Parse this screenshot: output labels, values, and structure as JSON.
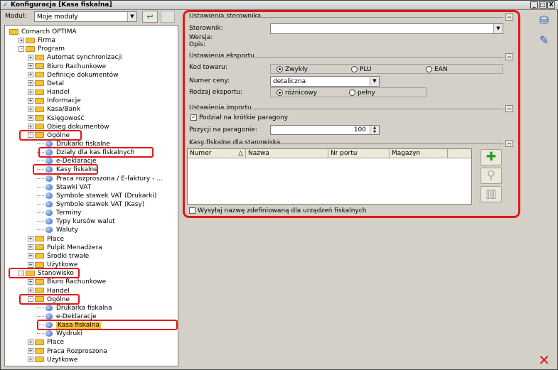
{
  "window": {
    "title": "Konfiguracja [Kasa fiskalna]"
  },
  "module": {
    "label": "Moduł:",
    "value": "Moje moduły"
  },
  "tree": [
    {
      "label": "Comarch OPTIMA",
      "kind": "folder",
      "expander": ""
    },
    {
      "label": "Firma",
      "kind": "folder",
      "expander": "+"
    },
    {
      "label": "Program",
      "kind": "folder",
      "expander": "-"
    },
    {
      "label": "Automat synchronizacji",
      "kind": "folder",
      "expander": "+"
    },
    {
      "label": "Biuro Rachunkowe",
      "kind": "folder",
      "expander": "+"
    },
    {
      "label": "Definicje dokumentów",
      "kind": "folder",
      "expander": "+"
    },
    {
      "label": "Detal",
      "kind": "folder",
      "expander": "+"
    },
    {
      "label": "Handel",
      "kind": "folder",
      "expander": "+"
    },
    {
      "label": "Informacje",
      "kind": "folder",
      "expander": "+"
    },
    {
      "label": "Kasa/Bank",
      "kind": "folder",
      "expander": "+"
    },
    {
      "label": "Księgowość",
      "kind": "folder",
      "expander": "+"
    },
    {
      "label": "Obieg dokumentów",
      "kind": "folder",
      "expander": "+"
    },
    {
      "label": "Ogólne",
      "kind": "folder",
      "expander": "-"
    },
    {
      "label": "Drukarki fiskalne",
      "kind": "leaf",
      "expander": ""
    },
    {
      "label": "Działy dla kas fiskalnych",
      "kind": "leaf",
      "expander": ""
    },
    {
      "label": "e-Deklaracje",
      "kind": "leaf",
      "expander": ""
    },
    {
      "label": "Kasy fiskalne",
      "kind": "leaf",
      "expander": ""
    },
    {
      "label": "Praca rozproszona / E-faktury - ...",
      "kind": "leaf",
      "expander": ""
    },
    {
      "label": "Stawki VAT",
      "kind": "leaf",
      "expander": ""
    },
    {
      "label": "Symbole stawek VAT (Drukarki)",
      "kind": "leaf",
      "expander": ""
    },
    {
      "label": "Symbole stawek VAT (Kasy)",
      "kind": "leaf",
      "expander": ""
    },
    {
      "label": "Terminy",
      "kind": "leaf",
      "expander": ""
    },
    {
      "label": "Typy kursów walut",
      "kind": "leaf",
      "expander": ""
    },
    {
      "label": "Waluty",
      "kind": "leaf",
      "expander": ""
    },
    {
      "label": "Płace",
      "kind": "folder",
      "expander": "+"
    },
    {
      "label": "Pulpit Menadżera",
      "kind": "folder",
      "expander": "+"
    },
    {
      "label": "Środki trwałe",
      "kind": "folder",
      "expander": "+"
    },
    {
      "label": "Użytkowe",
      "kind": "folder",
      "expander": "+"
    },
    {
      "label": "Stanowisko",
      "kind": "folder",
      "expander": "-"
    },
    {
      "label": "Biuro Rachunkowe",
      "kind": "folder",
      "expander": "+"
    },
    {
      "label": "Handel",
      "kind": "folder",
      "expander": "+"
    },
    {
      "label": "Ogólne",
      "kind": "folder",
      "expander": "-"
    },
    {
      "label": "Drukarka fiskalna",
      "kind": "leaf",
      "expander": ""
    },
    {
      "label": "e-Deklaracje",
      "kind": "leaf",
      "expander": ""
    },
    {
      "label": "Kasa fiskalna",
      "kind": "leaf",
      "expander": "",
      "selected": true
    },
    {
      "label": "Wydruki",
      "kind": "leaf",
      "expander": ""
    },
    {
      "label": "Płace",
      "kind": "folder",
      "expander": "+"
    },
    {
      "label": "Praca Rozproszona",
      "kind": "folder",
      "expander": "+"
    },
    {
      "label": "Użytkowe",
      "kind": "folder",
      "expander": "+"
    }
  ],
  "sterownik": {
    "section": "Ustawienia sterownika",
    "label": "Sterownik:",
    "value": "",
    "wersja_label": "Wersja:",
    "opis_label": "Opis:"
  },
  "eksport": {
    "section": "Ustawienia eksportu",
    "kod_label": "Kod towaru:",
    "kod_options": [
      "Zwykły",
      "PLU",
      "EAN"
    ],
    "cena_label": "Numer ceny:",
    "cena_value": "detaliczna",
    "rodzaj_label": "Rodzaj eksportu:",
    "rodzaj_options": [
      "różnicowy",
      "pełny"
    ]
  },
  "import": {
    "section": "Ustawienia importu",
    "podzial_label": "Podział na krótkie paragony",
    "podzial_checked": true,
    "pozycji_label": "Pozycji na paragonie:",
    "pozycji_value": "100"
  },
  "kasy": {
    "section": "Kasy fiskalne dla stanowiska",
    "columns": [
      "Numer",
      "Nazwa",
      "Nr portu",
      "Magazyn"
    ]
  },
  "wysylaj": {
    "label": "Wysyłaj nazwę zdefiniowaną dla urządzeń fiskalnych",
    "checked": false
  },
  "titlebar_buttons": [
    "_",
    "□",
    "X"
  ],
  "colors": {
    "highlight": "#e01818",
    "folder": "#f2c43c"
  }
}
